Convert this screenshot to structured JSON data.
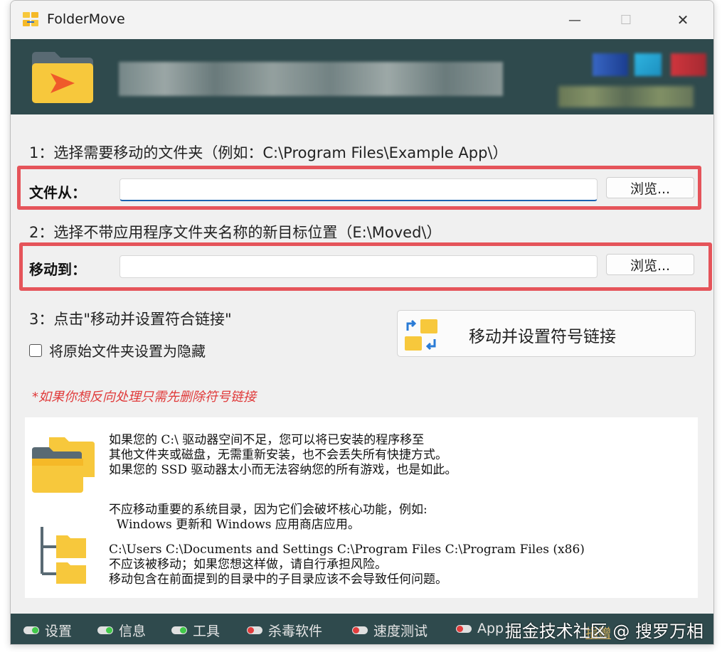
{
  "window": {
    "title": "FolderMove",
    "controls": {
      "minimize": "—",
      "maximize": "☐",
      "close": "✕"
    }
  },
  "step1": {
    "label": "1：选择需要移动的文件夹（例如：C:\\Program Files\\Example App\\）",
    "field_label": "文件从：",
    "value": "",
    "browse": "浏览..."
  },
  "step2": {
    "label": "2：选择不带应用程序文件夹名称的新目标位置（E:\\Moved\\）",
    "field_label": "移动到：",
    "value": "",
    "browse": "浏览..."
  },
  "step3": {
    "label": "3：点击\"移动并设置符合链接\"",
    "button": "移动并设置符号链接",
    "checkbox": "将原始文件夹设置为隐藏",
    "checked": false
  },
  "warning": "*如果你想反向处理只需先删除符号链接",
  "info": {
    "lines": [
      "如果您的 C:\\ 驱动器空间不足，您可以将已安装的程序移至",
      "其他文件夹或磁盘，无需重新安装，也不会丢失所有快捷方式。",
      "如果您的 SSD 驱动器太小而无法容纳您的所有游戏，也是如此。",
      "不应移动重要的系统目录，因为它们会破坏核心功能，例如:",
      "  Windows 更新和 Windows 应用商店应用。",
      "C:\\Users C:\\Documents and Settings C:\\Program Files C:\\Program Files (x86)",
      "不应该被移动；如果您想这样做，请自行承担风险。",
      "移动包含在前面提到的目录中的子目录应该不会导致任何问题。"
    ]
  },
  "bottom_nav": [
    {
      "label": "设置",
      "status": "green"
    },
    {
      "label": "信息",
      "status": "green"
    },
    {
      "label": "工具",
      "status": "green"
    },
    {
      "label": "杀毒软件",
      "status": "red"
    },
    {
      "label": "速度测试",
      "status": "red"
    },
    {
      "label": "App",
      "status": "red"
    }
  ],
  "donate": "捐赠",
  "watermark": "掘金技术社区 @ 搜罗万相",
  "colors": {
    "banner": "#2f4a4d",
    "highlight_border": "#e5545a",
    "warning_text": "#e03a3a",
    "folder_yellow": "#f7c83c"
  },
  "icons": {
    "app": "folder-move-icon",
    "banner": "folder-play-icon",
    "button": "folder-swap-icon",
    "info1": "folders-icon",
    "info2": "folder-tree-icon"
  }
}
